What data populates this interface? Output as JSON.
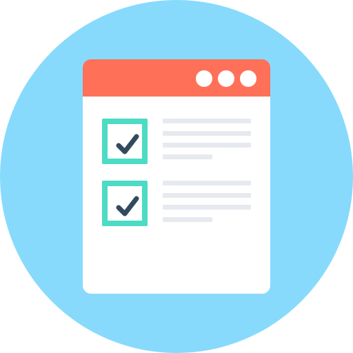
{
  "icon": {
    "name": "checklist-window-icon",
    "colors": {
      "background_circle": "#87DAFC",
      "window_body": "#FFFFFF",
      "titlebar": "#FF7058",
      "titlebar_dots": "#FFFFFF",
      "checkbox_border": "#4CDBC4",
      "checkmark": "#334A5E",
      "text_lines": "#E6E9EE"
    },
    "titlebar_dot_count": 3,
    "items": [
      {
        "checked": true,
        "line_count": 4
      },
      {
        "checked": true,
        "line_count": 4
      }
    ]
  }
}
